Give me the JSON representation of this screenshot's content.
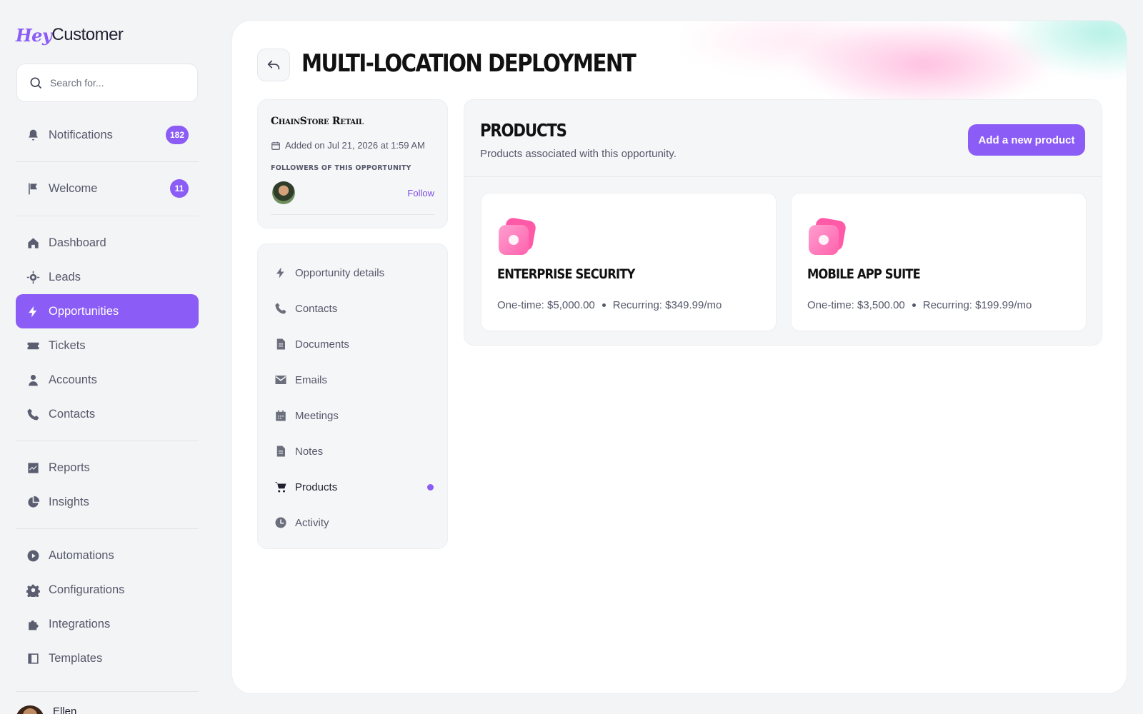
{
  "brand": {
    "logo_hey": "Hey",
    "logo_customer": "Customer"
  },
  "search": {
    "placeholder": "Search for..."
  },
  "sidebar": {
    "items": [
      {
        "label": "Notifications",
        "badge": "182",
        "icon": "bell-icon"
      },
      {
        "label": "Welcome",
        "badge": "11",
        "icon": "flag-icon"
      },
      {
        "label": "Dashboard",
        "icon": "home-icon"
      },
      {
        "label": "Leads",
        "icon": "target-icon"
      },
      {
        "label": "Opportunities",
        "icon": "bolt-icon",
        "active": true
      },
      {
        "label": "Tickets",
        "icon": "ticket-icon"
      },
      {
        "label": "Accounts",
        "icon": "user-icon"
      },
      {
        "label": "Contacts",
        "icon": "phone-icon"
      },
      {
        "label": "Reports",
        "icon": "chart-icon"
      },
      {
        "label": "Insights",
        "icon": "pie-icon"
      },
      {
        "label": "Automations",
        "icon": "play-icon"
      },
      {
        "label": "Configurations",
        "icon": "gear-icon"
      },
      {
        "label": "Integrations",
        "icon": "puzzle-icon"
      },
      {
        "label": "Templates",
        "icon": "template-icon"
      }
    ],
    "user_name": "Ellen"
  },
  "header": {
    "title": "Multi-location Deployment"
  },
  "company": {
    "name": "ChainStore Retail",
    "added": "Added on Jul 21, 2026 at 1:59 AM",
    "followers_label": "Followers of this opportunity",
    "follow_label": "Follow"
  },
  "menu": {
    "items": [
      {
        "label": "Opportunity details",
        "icon": "bolt-icon"
      },
      {
        "label": "Contacts",
        "icon": "phone-icon"
      },
      {
        "label": "Documents",
        "icon": "document-icon"
      },
      {
        "label": "Emails",
        "icon": "mail-icon"
      },
      {
        "label": "Meetings",
        "icon": "calendar-icon"
      },
      {
        "label": "Notes",
        "icon": "note-icon"
      },
      {
        "label": "Products",
        "icon": "cart-icon",
        "active": true
      },
      {
        "label": "Activity",
        "icon": "clock-icon"
      }
    ]
  },
  "products": {
    "title": "Products",
    "subtitle": "Products associated with this opportunity.",
    "add_label": "Add a new product",
    "list": [
      {
        "name": "Enterprise Security",
        "one_time": "One-time: $5,000.00",
        "recurring": "Recurring: $349.99/mo"
      },
      {
        "name": "Mobile App Suite",
        "one_time": "One-time: $3,500.00",
        "recurring": "Recurring: $199.99/mo"
      }
    ]
  },
  "colors": {
    "accent": "#8b5cf6",
    "product_icon": "#ff5aa8",
    "background": "#f3f4f6"
  }
}
